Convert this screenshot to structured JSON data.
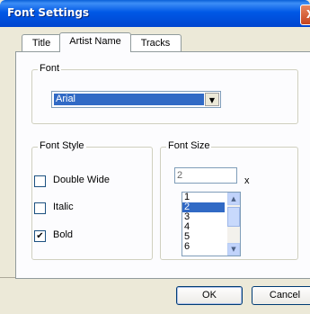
{
  "window": {
    "title": "Font Settings",
    "close_icon": "X"
  },
  "tabs": [
    {
      "label": "Title",
      "active": false
    },
    {
      "label": "Artist Name",
      "active": true
    },
    {
      "label": "Tracks",
      "active": false
    }
  ],
  "font_group": {
    "legend": "Font",
    "selected": "Arial",
    "arrow": "▼"
  },
  "font_style_group": {
    "legend": "Font Style",
    "options": [
      {
        "label": "Double Wide",
        "checked": false
      },
      {
        "label": "Italic",
        "checked": false
      },
      {
        "label": "Bold",
        "checked": true
      }
    ],
    "check_mark": "✔"
  },
  "font_size_group": {
    "legend": "Font Size",
    "value": "2",
    "suffix": "x",
    "options": [
      "1",
      "2",
      "3",
      "4",
      "5",
      "6"
    ],
    "selected_index": 1,
    "scroll_up": "▲",
    "scroll_down": "▼"
  },
  "buttons": {
    "ok": "OK",
    "cancel": "Cancel"
  },
  "colors": {
    "accent": "#316ac5",
    "titlebar": "#0058e6",
    "dialog_bg": "#ece9d8"
  }
}
